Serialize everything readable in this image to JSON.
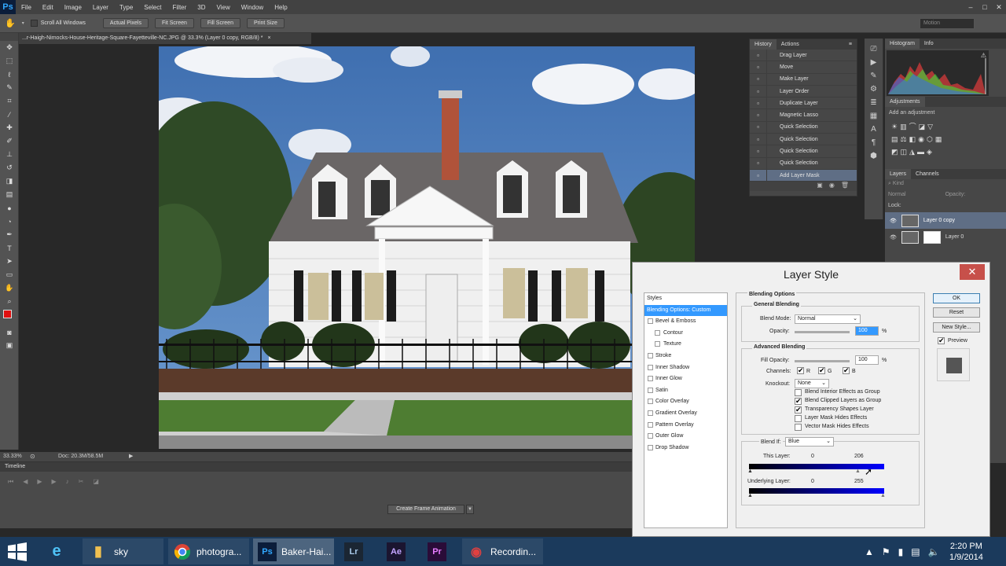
{
  "app": {
    "logo": "Ps"
  },
  "menu": [
    "File",
    "Edit",
    "Image",
    "Layer",
    "Type",
    "Select",
    "Filter",
    "3D",
    "View",
    "Window",
    "Help"
  ],
  "window_controls": [
    "–",
    "□",
    "✕"
  ],
  "workspace": "Motion",
  "options_bar": {
    "scroll_all_windows": "Scroll All Windows",
    "buttons": [
      "Actual Pixels",
      "Fit Screen",
      "Fill Screen",
      "Print Size"
    ]
  },
  "document": {
    "tab_title": "...r-Haigh-Nimocks-House-Heritage-Square-Fayetteville-NC.JPG @ 33.3% (Layer 0 copy, RGB/8) *",
    "tab_close": "×",
    "zoom": "33.33%",
    "doc_info": "Doc: 20.3M/58.5M"
  },
  "timeline": {
    "title": "Timeline",
    "create_button": "Create Frame Animation"
  },
  "history": {
    "tabs": [
      "History",
      "Actions"
    ],
    "items": [
      "Drag Layer",
      "Move",
      "Make Layer",
      "Layer Order",
      "Duplicate Layer",
      "Magnetic Lasso",
      "Quick Selection",
      "Quick Selection",
      "Quick Selection",
      "Quick Selection",
      "Add Layer Mask"
    ],
    "selected_index": 10
  },
  "histogram": {
    "tabs": [
      "Histogram",
      "Info"
    ]
  },
  "adjustments": {
    "title": "Adjustments",
    "subtitle": "Add an adjustment"
  },
  "layers": {
    "tabs": [
      "Layers",
      "Channels"
    ],
    "kind": "Kind",
    "mode": "Normal",
    "opacity_label": "Opacity:",
    "lock_label": "Lock:",
    "items": [
      "Layer 0 copy",
      "Layer 0"
    ]
  },
  "layer_style": {
    "title": "Layer Style",
    "close": "✕",
    "styles_header": "Styles",
    "styles": [
      {
        "label": "Blending Options: Custom",
        "selected": true,
        "sub": false,
        "hdr": true
      },
      {
        "label": "Bevel & Emboss",
        "sub": false
      },
      {
        "label": "Contour",
        "sub": true
      },
      {
        "label": "Texture",
        "sub": true
      },
      {
        "label": "Stroke",
        "sub": false
      },
      {
        "label": "Inner Shadow",
        "sub": false
      },
      {
        "label": "Inner Glow",
        "sub": false
      },
      {
        "label": "Satin",
        "sub": false
      },
      {
        "label": "Color Overlay",
        "sub": false
      },
      {
        "label": "Gradient Overlay",
        "sub": false
      },
      {
        "label": "Pattern Overlay",
        "sub": false
      },
      {
        "label": "Outer Glow",
        "sub": false
      },
      {
        "label": "Drop Shadow",
        "sub": false
      }
    ],
    "blending_options": "Blending Options",
    "general_blending": "General Blending",
    "blend_mode_label": "Blend Mode:",
    "blend_mode": "Normal",
    "opacity_label": "Opacity:",
    "opacity": "100",
    "percent": "%",
    "advanced_blending": "Advanced Blending",
    "fill_opacity_label": "Fill Opacity:",
    "fill_opacity": "100",
    "channels_label": "Channels:",
    "channels": [
      "R",
      "G",
      "B"
    ],
    "knockout_label": "Knockout:",
    "knockout": "None",
    "options": [
      {
        "label": "Blend Interior Effects as Group",
        "checked": false
      },
      {
        "label": "Blend Clipped Layers as Group",
        "checked": true
      },
      {
        "label": "Transparency Shapes Layer",
        "checked": true
      },
      {
        "label": "Layer Mask Hides Effects",
        "checked": false
      },
      {
        "label": "Vector Mask Hides Effects",
        "checked": false
      }
    ],
    "blend_if_label": "Blend If:",
    "blend_if": "Blue",
    "this_layer_label": "This Layer:",
    "this_layer_low": "0",
    "this_layer_high": "206",
    "underlying_label": "Underlying Layer:",
    "underlying_low": "0",
    "underlying_high": "255",
    "buttons": {
      "ok": "OK",
      "reset": "Reset",
      "new_style": "New Style...",
      "preview": "Preview"
    }
  },
  "taskbar": {
    "items": [
      "sky",
      "photogra...",
      "Baker-Hai...",
      "Recordin..."
    ],
    "app_icons": [
      "Lr",
      "Ae",
      "Pr"
    ],
    "ps_icon": "Ps",
    "time": "2:20 PM",
    "date": "1/9/2014"
  }
}
